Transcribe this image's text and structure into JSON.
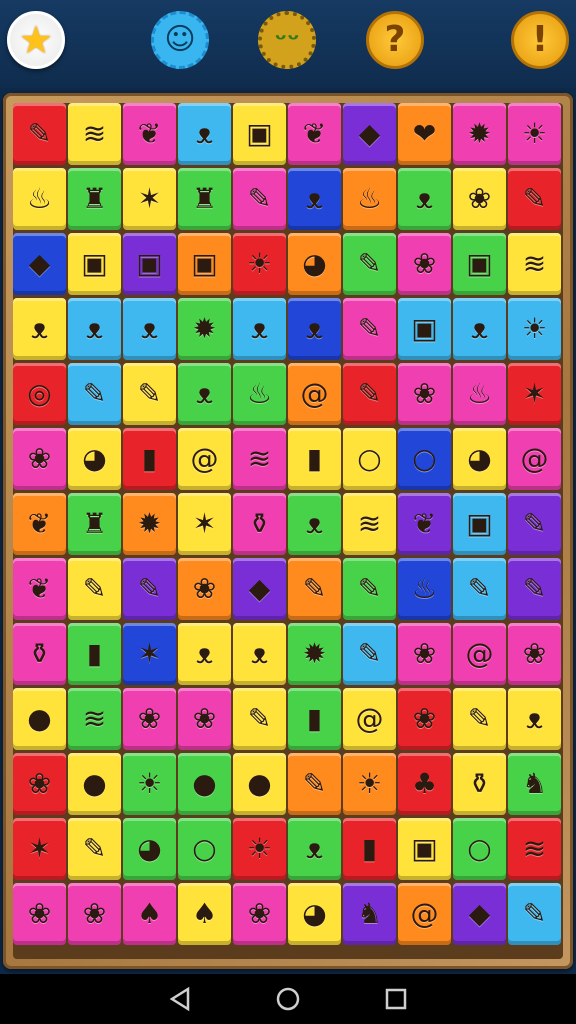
{
  "header": {
    "buttons": [
      {
        "icon": "star-icon",
        "glyph": "★"
      },
      {
        "icon": "smiley-badge-icon",
        "glyph": "☺"
      },
      {
        "icon": "monster-badge-icon",
        "glyph": "ᵕᵕ"
      },
      {
        "icon": "help-icon",
        "glyph": "?"
      },
      {
        "icon": "alert-icon",
        "glyph": "!"
      }
    ]
  },
  "colors": {
    "red": "#e8232a",
    "yellow": "#ffe23a",
    "magenta": "#f03fb0",
    "sky": "#3fb8f0",
    "green": "#48d24a",
    "purple": "#7a2fd6",
    "orange": "#ff8a1e",
    "lime": "#9ee02a",
    "blue": "#2146d8"
  },
  "icons": {
    "marker": "✎",
    "candy": "≋",
    "leaf": "❦",
    "cat": "ᴥ",
    "box": "▣",
    "cube": "◆",
    "strawberry": "❤",
    "gear": "✹",
    "sun": "☀",
    "flame": "♨",
    "hat": "♜",
    "star": "✶",
    "blob": "❀",
    "donut": "◎",
    "ring": "○",
    "smile": "☺",
    "swirl": "@",
    "battery": "▮",
    "monster": "♣",
    "bottle": "⚱",
    "fruit": "◕",
    "apple": "●",
    "bell": "♞",
    "pepper": "♠"
  },
  "board": {
    "rows": [
      [
        [
          "red",
          "marker"
        ],
        [
          "yellow",
          "candy"
        ],
        [
          "magenta",
          "leaf"
        ],
        [
          "sky",
          "cat"
        ],
        [
          "yellow",
          "box"
        ],
        [
          "magenta",
          "leaf"
        ],
        [
          "purple",
          "cube"
        ],
        [
          "orange",
          "strawberry"
        ],
        [
          "magenta",
          "gear"
        ],
        [
          "magenta",
          "sun"
        ]
      ],
      [
        [
          "yellow",
          "flame"
        ],
        [
          "green",
          "hat"
        ],
        [
          "yellow",
          "star"
        ],
        [
          "green",
          "hat"
        ],
        [
          "magenta",
          "marker"
        ],
        [
          "blue",
          "cat"
        ],
        [
          "orange",
          "flame"
        ],
        [
          "green",
          "cat"
        ],
        [
          "yellow",
          "blob"
        ],
        [
          "red",
          "marker"
        ]
      ],
      [
        [
          "blue",
          "cube"
        ],
        [
          "yellow",
          "box"
        ],
        [
          "purple",
          "box"
        ],
        [
          "orange",
          "box"
        ],
        [
          "red",
          "sun"
        ],
        [
          "orange",
          "fruit"
        ],
        [
          "green",
          "marker"
        ],
        [
          "magenta",
          "blob"
        ],
        [
          "green",
          "box"
        ],
        [
          "yellow",
          "candy"
        ]
      ],
      [
        [
          "yellow",
          "cat"
        ],
        [
          "sky",
          "cat"
        ],
        [
          "sky",
          "cat"
        ],
        [
          "green",
          "gear"
        ],
        [
          "sky",
          "cat"
        ],
        [
          "blue",
          "cat"
        ],
        [
          "magenta",
          "marker"
        ],
        [
          "sky",
          "box"
        ],
        [
          "sky",
          "cat"
        ],
        [
          "sky",
          "sun"
        ]
      ],
      [
        [
          "red",
          "donut"
        ],
        [
          "sky",
          "marker"
        ],
        [
          "yellow",
          "marker"
        ],
        [
          "green",
          "cat"
        ],
        [
          "green",
          "flame"
        ],
        [
          "orange",
          "swirl"
        ],
        [
          "red",
          "marker"
        ],
        [
          "magenta",
          "blob"
        ],
        [
          "magenta",
          "flame"
        ],
        [
          "red",
          "star"
        ]
      ],
      [
        [
          "magenta",
          "blob"
        ],
        [
          "yellow",
          "fruit"
        ],
        [
          "red",
          "battery"
        ],
        [
          "yellow",
          "swirl"
        ],
        [
          "magenta",
          "candy"
        ],
        [
          "yellow",
          "battery"
        ],
        [
          "yellow",
          "ring"
        ],
        [
          "blue",
          "ring"
        ],
        [
          "yellow",
          "fruit"
        ],
        [
          "magenta",
          "swirl"
        ]
      ],
      [
        [
          "orange",
          "leaf"
        ],
        [
          "green",
          "hat"
        ],
        [
          "orange",
          "gear"
        ],
        [
          "yellow",
          "star"
        ],
        [
          "magenta",
          "bottle"
        ],
        [
          "green",
          "cat"
        ],
        [
          "yellow",
          "candy"
        ],
        [
          "purple",
          "leaf"
        ],
        [
          "sky",
          "box"
        ],
        [
          "purple",
          "marker"
        ]
      ],
      [
        [
          "magenta",
          "leaf"
        ],
        [
          "yellow",
          "marker"
        ],
        [
          "purple",
          "marker"
        ],
        [
          "orange",
          "blob"
        ],
        [
          "purple",
          "cube"
        ],
        [
          "orange",
          "marker"
        ],
        [
          "green",
          "marker"
        ],
        [
          "blue",
          "flame"
        ],
        [
          "sky",
          "marker"
        ],
        [
          "purple",
          "marker"
        ]
      ],
      [
        [
          "magenta",
          "bottle"
        ],
        [
          "green",
          "battery"
        ],
        [
          "blue",
          "star"
        ],
        [
          "yellow",
          "cat"
        ],
        [
          "yellow",
          "cat"
        ],
        [
          "green",
          "gear"
        ],
        [
          "sky",
          "marker"
        ],
        [
          "magenta",
          "blob"
        ],
        [
          "magenta",
          "swirl"
        ],
        [
          "magenta",
          "blob"
        ]
      ],
      [
        [
          "yellow",
          "apple"
        ],
        [
          "green",
          "candy"
        ],
        [
          "magenta",
          "blob"
        ],
        [
          "magenta",
          "blob"
        ],
        [
          "yellow",
          "marker"
        ],
        [
          "green",
          "battery"
        ],
        [
          "yellow",
          "swirl"
        ],
        [
          "red",
          "blob"
        ],
        [
          "yellow",
          "marker"
        ],
        [
          "yellow",
          "cat"
        ]
      ],
      [
        [
          "red",
          "blob"
        ],
        [
          "yellow",
          "apple"
        ],
        [
          "green",
          "sun"
        ],
        [
          "green",
          "apple"
        ],
        [
          "yellow",
          "apple"
        ],
        [
          "orange",
          "marker"
        ],
        [
          "orange",
          "sun"
        ],
        [
          "red",
          "monster"
        ],
        [
          "yellow",
          "bottle"
        ],
        [
          "green",
          "bell"
        ]
      ],
      [
        [
          "red",
          "star"
        ],
        [
          "yellow",
          "marker"
        ],
        [
          "green",
          "fruit"
        ],
        [
          "green",
          "ring"
        ],
        [
          "red",
          "sun"
        ],
        [
          "green",
          "cat"
        ],
        [
          "red",
          "battery"
        ],
        [
          "yellow",
          "box"
        ],
        [
          "green",
          "ring"
        ],
        [
          "red",
          "candy"
        ]
      ],
      [
        [
          "magenta",
          "blob"
        ],
        [
          "magenta",
          "blob"
        ],
        [
          "magenta",
          "pepper"
        ],
        [
          "yellow",
          "pepper"
        ],
        [
          "magenta",
          "blob"
        ],
        [
          "yellow",
          "fruit"
        ],
        [
          "purple",
          "bell"
        ],
        [
          "orange",
          "swirl"
        ],
        [
          "purple",
          "cube"
        ],
        [
          "sky",
          "marker"
        ]
      ]
    ]
  },
  "nav": {
    "back": "◁",
    "home": "○",
    "recent": "□"
  }
}
